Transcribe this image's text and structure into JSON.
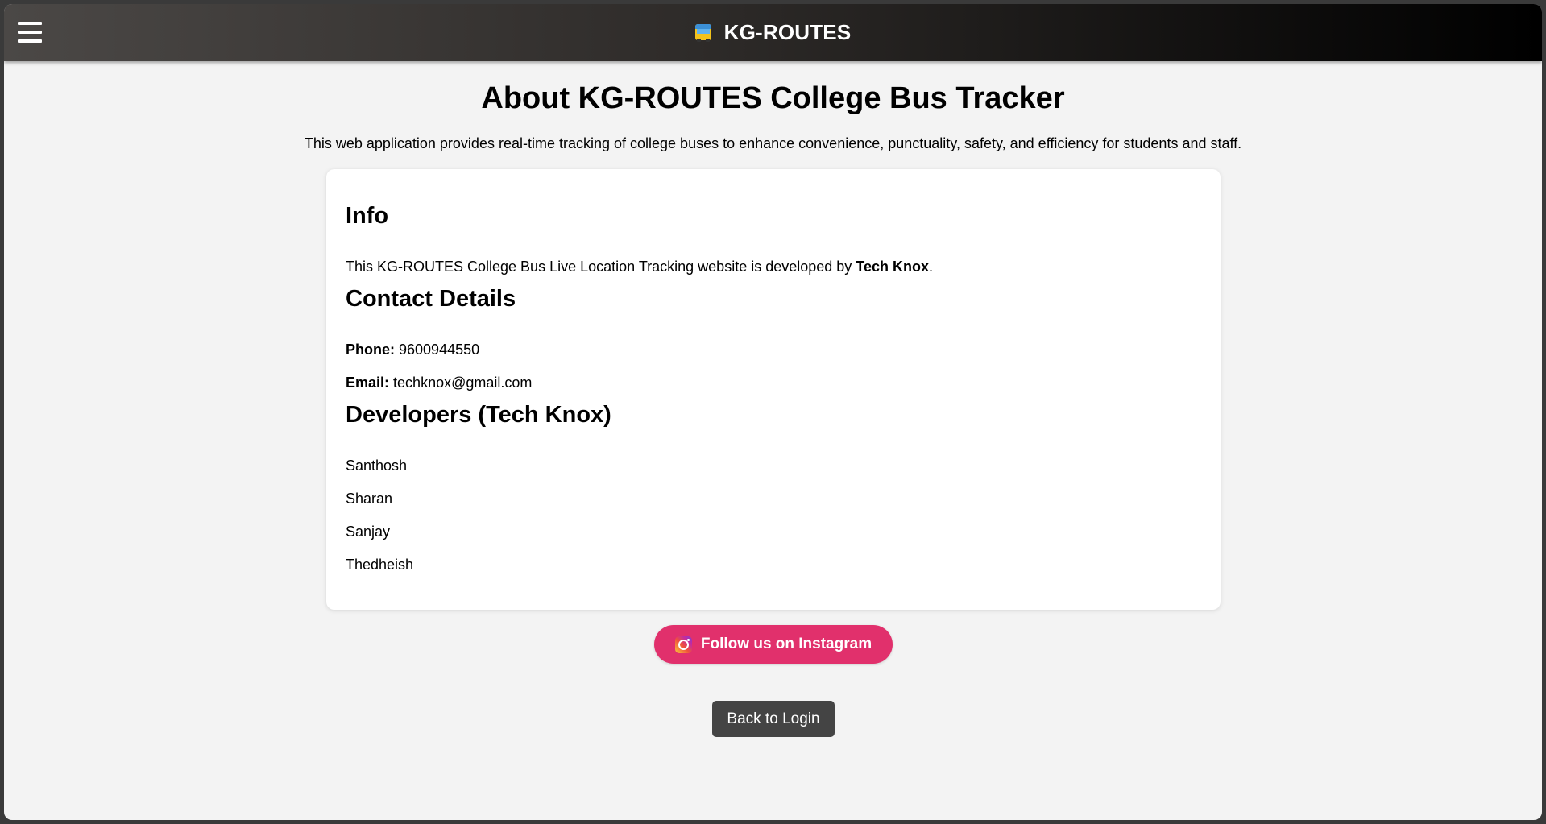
{
  "header": {
    "menu_icon": "hamburger-menu-icon",
    "brand_icon": "bus-icon",
    "brand_text": "KG-ROUTES"
  },
  "main": {
    "title": "About KG-ROUTES College Bus Tracker",
    "intro": "This web application provides real-time tracking of college buses to enhance convenience, punctuality, safety, and efficiency for students and staff."
  },
  "card": {
    "info": {
      "heading": "Info",
      "text_before": "This KG-ROUTES College Bus Live Location Tracking website is developed by ",
      "developer_org": "Tech Knox",
      "text_after": "."
    },
    "contact": {
      "heading": "Contact Details",
      "phone_label": "Phone:",
      "phone_value": "9600944550",
      "email_label": "Email:",
      "email_value": "techknox@gmail.com"
    },
    "developers": {
      "heading": "Developers (Tech Knox)",
      "names": [
        "Santhosh",
        "Sharan",
        "Sanjay",
        "Thedheish"
      ]
    }
  },
  "buttons": {
    "instagram_label": "Follow us on Instagram",
    "instagram_icon": "instagram-icon",
    "instagram_color": "#e1306c",
    "back_label": "Back to Login"
  }
}
